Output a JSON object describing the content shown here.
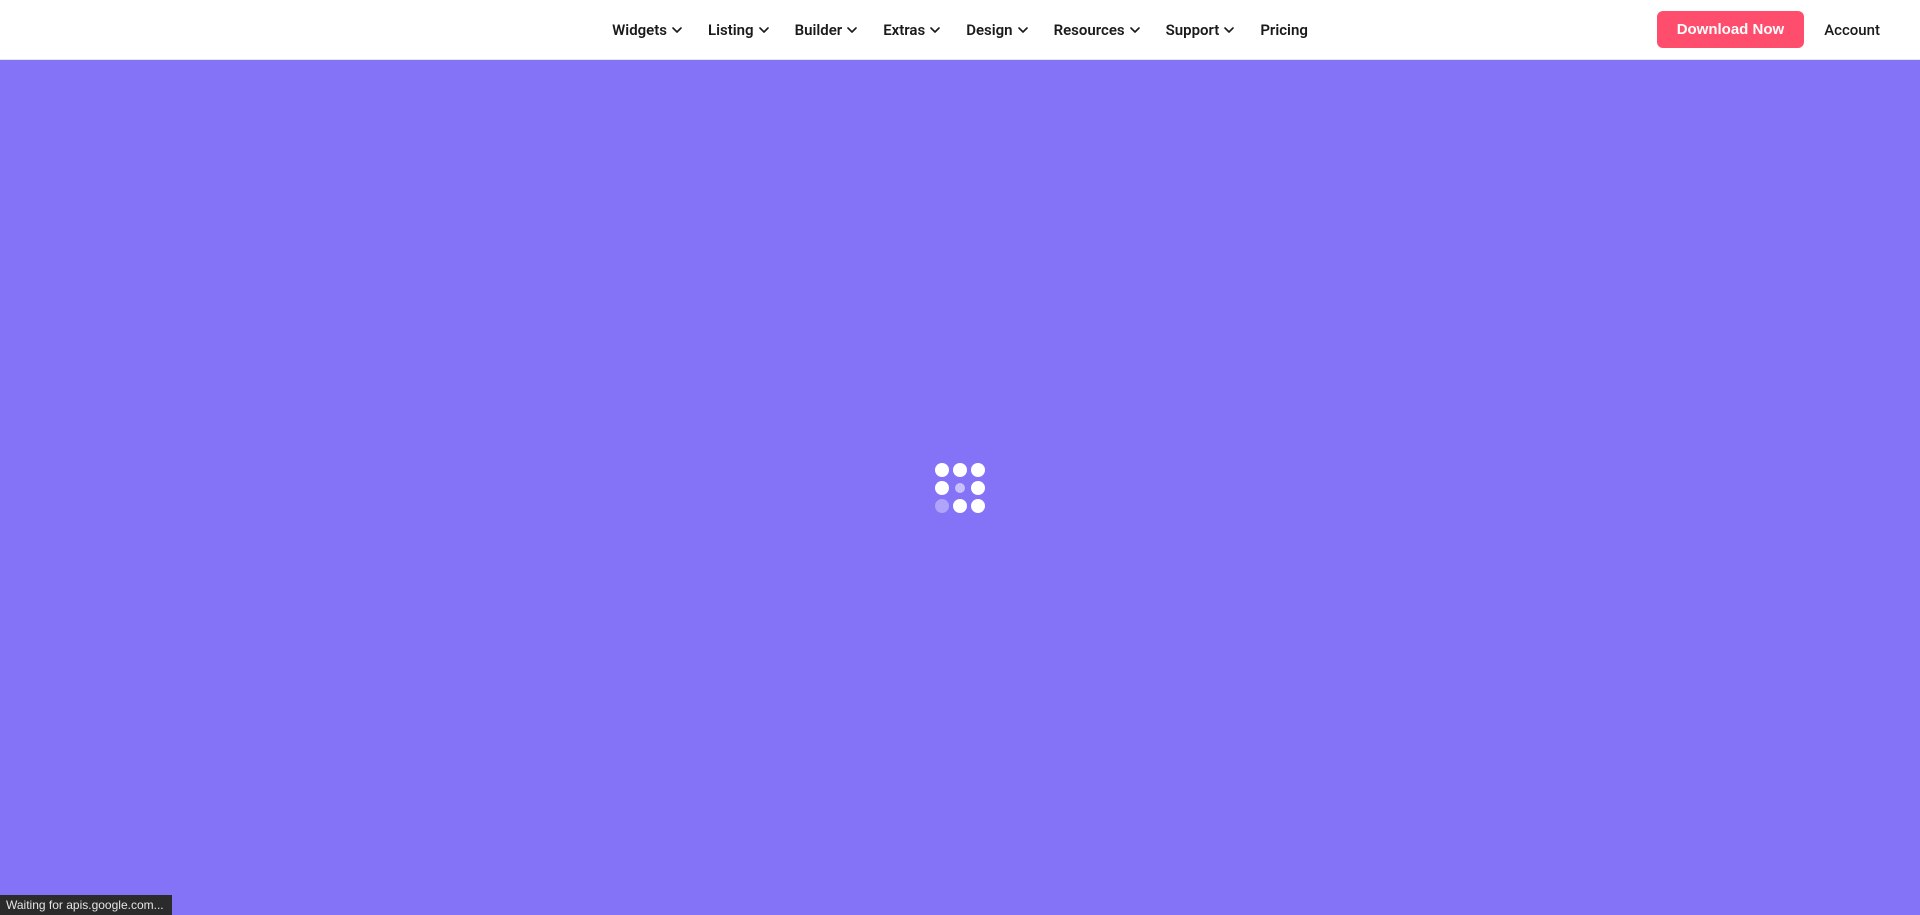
{
  "nav": {
    "items": [
      {
        "label": "Widgets",
        "hasDropdown": true
      },
      {
        "label": "Listing",
        "hasDropdown": true
      },
      {
        "label": "Builder",
        "hasDropdown": true
      },
      {
        "label": "Extras",
        "hasDropdown": true
      },
      {
        "label": "Design",
        "hasDropdown": true
      },
      {
        "label": "Resources",
        "hasDropdown": true
      },
      {
        "label": "Support",
        "hasDropdown": true
      },
      {
        "label": "Pricing",
        "hasDropdown": false
      }
    ]
  },
  "cta": {
    "download_label": "Download Now"
  },
  "account": {
    "label": "Account"
  },
  "status": {
    "text": "Waiting for apis.google.com..."
  },
  "colors": {
    "loading_bg": "#8473f6",
    "cta_bg": "#ff4d6d"
  }
}
